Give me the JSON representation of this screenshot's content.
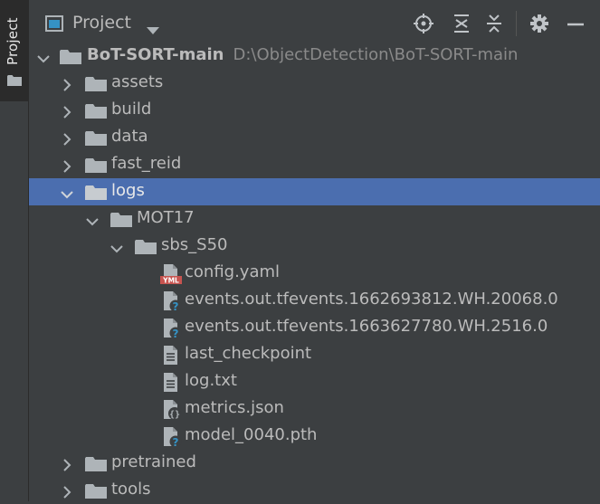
{
  "toolwindow": {
    "strip_label": "Project"
  },
  "header": {
    "title": "Project"
  },
  "tree": {
    "root": {
      "name": "BoT-SORT-main",
      "path": "D:\\ObjectDetection\\BoT-SORT-main"
    },
    "items": [
      {
        "label": "assets",
        "type": "folder",
        "state": "collapsed"
      },
      {
        "label": "build",
        "type": "folder",
        "state": "collapsed"
      },
      {
        "label": "data",
        "type": "folder",
        "state": "collapsed"
      },
      {
        "label": "fast_reid",
        "type": "folder",
        "state": "collapsed"
      },
      {
        "label": "logs",
        "type": "folder",
        "state": "expanded"
      },
      {
        "label": "MOT17",
        "type": "folder",
        "state": "expanded"
      },
      {
        "label": "sbs_S50",
        "type": "folder",
        "state": "expanded"
      },
      {
        "label": "config.yaml",
        "type": "yaml-file"
      },
      {
        "label": "events.out.tfevents.1662693812.WH.20068.0",
        "type": "unknown-file"
      },
      {
        "label": "events.out.tfevents.1663627780.WH.2516.0",
        "type": "unknown-file"
      },
      {
        "label": "last_checkpoint",
        "type": "text-file"
      },
      {
        "label": "log.txt",
        "type": "text-file"
      },
      {
        "label": "metrics.json",
        "type": "json-file"
      },
      {
        "label": "model_0040.pth",
        "type": "unknown-file"
      },
      {
        "label": "pretrained",
        "type": "folder",
        "state": "collapsed"
      },
      {
        "label": "tools",
        "type": "folder",
        "state": "collapsed"
      }
    ],
    "selected": "logs"
  },
  "icons": {
    "yaml_badge": "YML",
    "json_badge": "{}",
    "unknown_badge": "?"
  },
  "colors": {
    "selection": "#4b6eaf",
    "folder": "#aeb4b8",
    "background": "#3c3f41"
  }
}
